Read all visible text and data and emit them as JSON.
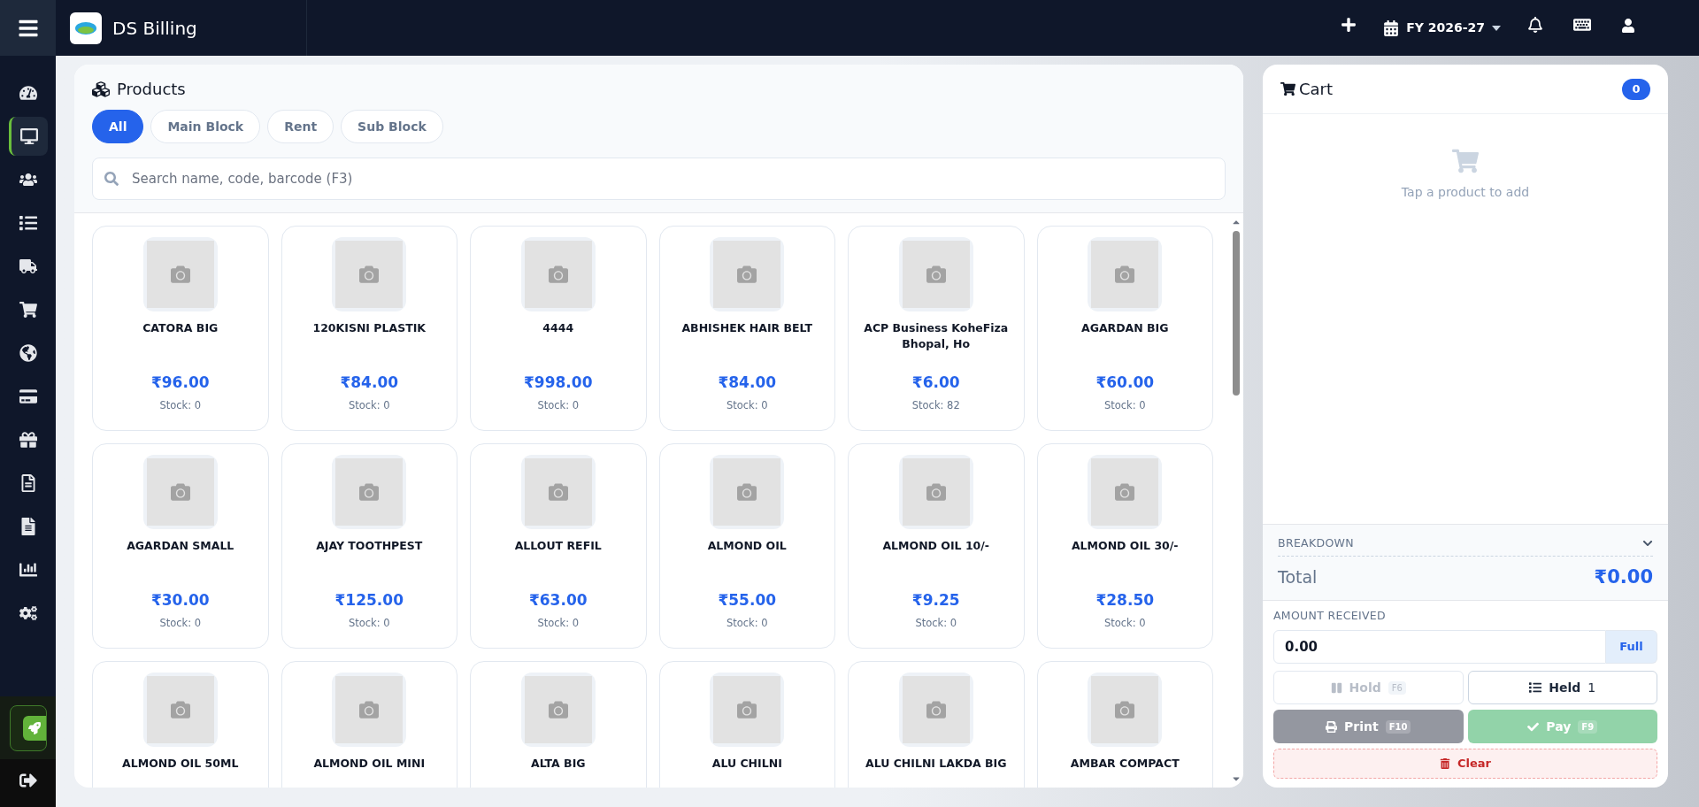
{
  "app": {
    "title": "DS Billing",
    "fiscal_year": "FY 2026-27"
  },
  "sidebar": {
    "items": [
      {
        "selected": false
      },
      {
        "selected": true
      },
      {
        "selected": false
      },
      {
        "selected": false
      },
      {
        "selected": false
      },
      {
        "selected": false
      },
      {
        "selected": false
      },
      {
        "selected": false
      },
      {
        "selected": false
      },
      {
        "selected": false
      },
      {
        "selected": false
      },
      {
        "selected": false
      },
      {
        "selected": false
      }
    ]
  },
  "products": {
    "title": "Products",
    "filters": [
      {
        "label": "All",
        "selected": true
      },
      {
        "label": "Main Block",
        "selected": false
      },
      {
        "label": "Rent",
        "selected": false
      },
      {
        "label": "Sub Block",
        "selected": false
      }
    ],
    "search": {
      "placeholder": "Search name, code, barcode (F3)"
    },
    "items": [
      {
        "name": "CATORA BIG",
        "price": "₹96.00",
        "stock": "Stock: 0"
      },
      {
        "name": "120KISNI PLASTIK",
        "price": "₹84.00",
        "stock": "Stock: 0"
      },
      {
        "name": "4444",
        "price": "₹998.00",
        "stock": "Stock: 0"
      },
      {
        "name": "ABHISHEK HAIR BELT",
        "price": "₹84.00",
        "stock": "Stock: 0"
      },
      {
        "name": "ACP Business KoheFiza Bhopal, Ho",
        "price": "₹6.00",
        "stock": "Stock: 82"
      },
      {
        "name": "AGARDAN BIG",
        "price": "₹60.00",
        "stock": "Stock: 0"
      },
      {
        "name": "AGARDAN SMALL",
        "price": "₹30.00",
        "stock": "Stock: 0"
      },
      {
        "name": "AJAY TOOTHPEST",
        "price": "₹125.00",
        "stock": "Stock: 0"
      },
      {
        "name": "ALLOUT REFIL",
        "price": "₹63.00",
        "stock": "Stock: 0"
      },
      {
        "name": "ALMOND OIL",
        "price": "₹55.00",
        "stock": "Stock: 0"
      },
      {
        "name": "ALMOND OIL 10/-",
        "price": "₹9.25",
        "stock": "Stock: 0"
      },
      {
        "name": "ALMOND OIL 30/-",
        "price": "₹28.50",
        "stock": "Stock: 0"
      },
      {
        "name": "ALMOND OIL 50ML"
      },
      {
        "name": "ALMOND OIL MINI"
      },
      {
        "name": "ALTA BIG"
      },
      {
        "name": "ALU CHILNI"
      },
      {
        "name": "ALU CHILNI LAKDA BIG"
      },
      {
        "name": "AMBAR COMPACT"
      }
    ]
  },
  "cart": {
    "title": "Cart",
    "count": "0",
    "empty_message": "Tap a product to add",
    "breakdown": {
      "label": "BREAKDOWN",
      "expanded": false
    },
    "total_label": "Total",
    "total": "₹0.00",
    "amount_received": {
      "label": "AMOUNT RECEIVED",
      "value": "0.00",
      "button": "Full"
    },
    "actions": [
      {
        "kind": "hold",
        "label": "Hold",
        "shortcut": "F6",
        "disabled": true
      },
      {
        "kind": "held",
        "label": "Held",
        "count": "1"
      },
      {
        "kind": "print",
        "label": "Print",
        "shortcut": "F10"
      },
      {
        "kind": "pay",
        "label": "Pay",
        "shortcut": "F9",
        "disabled": true
      },
      {
        "kind": "clear",
        "label": "Clear"
      }
    ]
  }
}
